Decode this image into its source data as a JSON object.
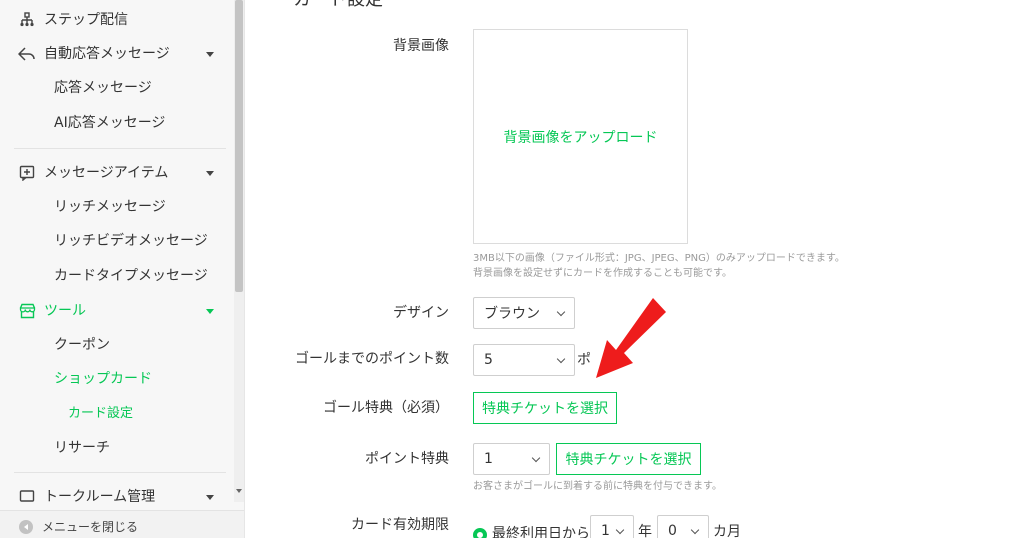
{
  "sidebar": {
    "items": [
      {
        "label": "ステップ配信",
        "icon": "hierarchy-icon"
      },
      {
        "label": "自動応答メッセージ",
        "icon": "reply-icon"
      },
      {
        "label": "応答メッセージ"
      },
      {
        "label": "AI応答メッセージ"
      },
      {
        "label": "メッセージアイテム",
        "icon": "add-message-icon"
      },
      {
        "label": "リッチメッセージ"
      },
      {
        "label": "リッチビデオメッセージ"
      },
      {
        "label": "カードタイプメッセージ"
      },
      {
        "label": "ツール",
        "icon": "shop-icon"
      },
      {
        "label": "クーポン"
      },
      {
        "label": "ショップカード"
      },
      {
        "label": "カード設定"
      },
      {
        "label": "リサーチ"
      },
      {
        "label": "トークルーム管理",
        "icon": "chat-room-icon"
      }
    ],
    "footer_label": "メニューを閉じる"
  },
  "main": {
    "section_title": "カード設定",
    "background": {
      "label": "背景画像",
      "upload_text": "背景画像をアップロード",
      "hint_line1": "3MB以下の画像（ファイル形式：JPG、JPEG、PNG）のみアップロードできます。",
      "hint_line2": "背景画像を設定せずにカードを作成することも可能です。"
    },
    "design": {
      "label": "デザイン",
      "value": "ブラウン"
    },
    "goal_points": {
      "label": "ゴールまでのポイント数",
      "value": "5",
      "suffix": "ポ"
    },
    "goal_reward": {
      "label": "ゴール特典（必須）",
      "button": "特典チケットを選択"
    },
    "point_reward": {
      "label": "ポイント特典",
      "value": "1",
      "button": "特典チケットを選択",
      "hint": "お客さまがゴールに到着する前に特典を付与できます。"
    },
    "expiry": {
      "label": "カード有効期限",
      "option": "最終利用日から",
      "years": "1",
      "years_unit": "年",
      "months": "0",
      "months_unit": "カ月"
    }
  },
  "colors": {
    "accent": "#06c755",
    "arrow": "#ee1c1c"
  }
}
